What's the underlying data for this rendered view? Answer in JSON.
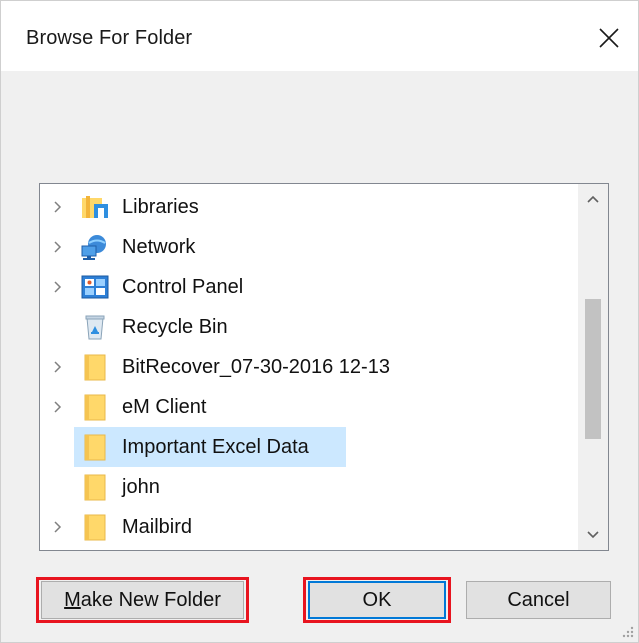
{
  "window": {
    "title": "Browse For Folder",
    "close_icon": "close-icon"
  },
  "tree": {
    "items": [
      {
        "label": "Libraries",
        "icon": "libraries-icon",
        "expandable": true,
        "selected": false
      },
      {
        "label": "Network",
        "icon": "network-icon",
        "expandable": true,
        "selected": false
      },
      {
        "label": "Control Panel",
        "icon": "control-panel-icon",
        "expandable": true,
        "selected": false
      },
      {
        "label": "Recycle Bin",
        "icon": "recycle-bin-icon",
        "expandable": false,
        "selected": false
      },
      {
        "label": "BitRecover_07-30-2016 12-13",
        "icon": "folder-icon",
        "expandable": true,
        "selected": false
      },
      {
        "label": "eM Client",
        "icon": "folder-icon",
        "expandable": true,
        "selected": false
      },
      {
        "label": "Important Excel Data",
        "icon": "folder-icon",
        "expandable": false,
        "selected": true
      },
      {
        "label": "john",
        "icon": "folder-icon",
        "expandable": false,
        "selected": false
      },
      {
        "label": "Mailbird",
        "icon": "folder-icon",
        "expandable": true,
        "selected": false
      }
    ]
  },
  "buttons": {
    "make_new_folder_mnemonic": "M",
    "make_new_folder_rest": "ake New Folder",
    "ok_label": "OK",
    "cancel_label": "Cancel"
  },
  "colors": {
    "selection": "#cce8ff",
    "annotation_highlight": "#e8141f",
    "default_button_border": "#0078d7",
    "folder_yellow": "#ffd86a"
  }
}
